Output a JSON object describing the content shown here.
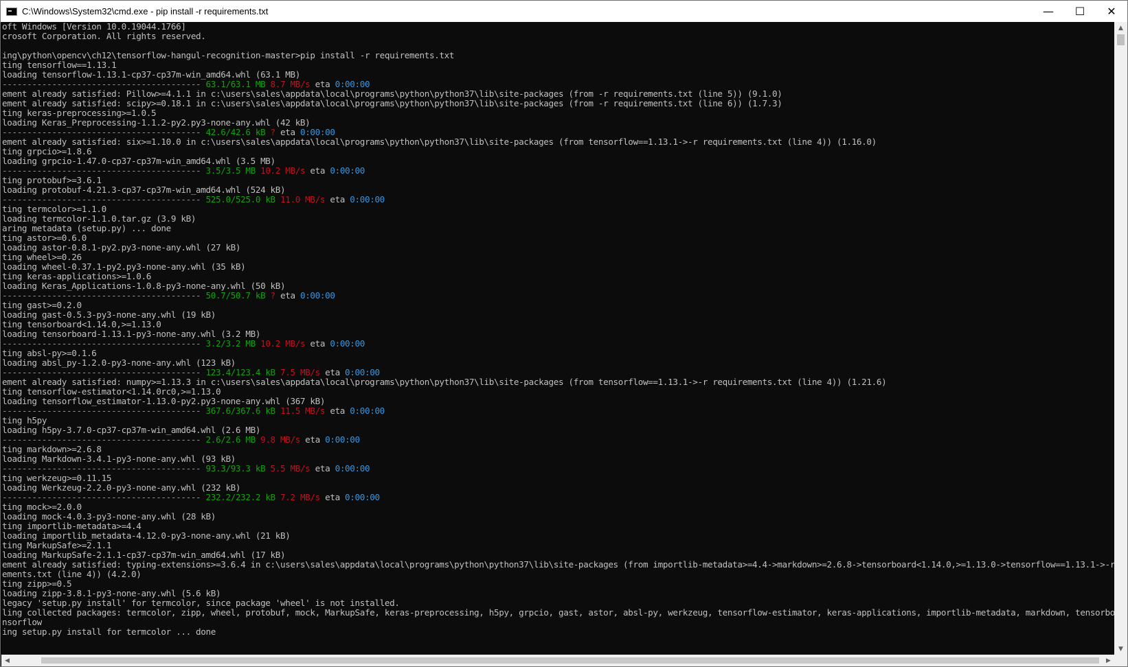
{
  "window": {
    "title": "C:\\Windows\\System32\\cmd.exe - pip  install -r requirements.txt",
    "minimize_glyph": "—",
    "maximize_glyph": "☐",
    "close_glyph": "✕"
  },
  "colors": {
    "text": "#c0c0c0",
    "green": "#13a10e",
    "red": "#c50f1f",
    "blue": "#3a96dd",
    "yellow": "#c19c00",
    "background": "#0c0c0c"
  },
  "console": {
    "lines": [
      {
        "segments": [
          {
            "t": "oft Windows [Version 10.0.19044.1766]"
          }
        ]
      },
      {
        "segments": [
          {
            "t": "crosoft Corporation. All rights reserved."
          }
        ]
      },
      {
        "segments": [
          {
            "t": ""
          }
        ]
      },
      {
        "segments": [
          {
            "t": "ing\\python\\opencv\\ch12\\tensorflow-hangul-recognition-master>pip install -r requirements.txt"
          }
        ]
      },
      {
        "segments": [
          {
            "t": "ting tensorflow==1.13.1"
          }
        ]
      },
      {
        "segments": [
          {
            "t": "loading tensorflow-1.13.1-cp37-cp37m-win_amd64.whl (63.1 MB)"
          }
        ]
      },
      {
        "segments": [
          {
            "t": "----------------------------------------",
            "c": "yellow"
          },
          {
            "t": " 63.1/63.1 MB",
            "c": "green"
          },
          {
            "t": " 8.7 MB/s",
            "c": "red"
          },
          {
            "t": " eta "
          },
          {
            "t": "0:00:00",
            "c": "blue"
          }
        ]
      },
      {
        "segments": [
          {
            "t": "ement already satisfied: Pillow>=4.1.1 in c:\\users\\sales\\appdata\\local\\programs\\python\\python37\\lib\\site-packages (from -r requirements.txt (line 5)) (9.1.0)"
          }
        ]
      },
      {
        "segments": [
          {
            "t": "ement already satisfied: scipy>=0.18.1 in c:\\users\\sales\\appdata\\local\\programs\\python\\python37\\lib\\site-packages (from -r requirements.txt (line 6)) (1.7.3)"
          }
        ]
      },
      {
        "segments": [
          {
            "t": "ting keras-preprocessing>=1.0.5"
          }
        ]
      },
      {
        "segments": [
          {
            "t": "loading Keras_Preprocessing-1.1.2-py2.py3-none-any.whl (42 kB)"
          }
        ]
      },
      {
        "segments": [
          {
            "t": "----------------------------------------",
            "c": "yellow"
          },
          {
            "t": " 42.6/42.6 kB",
            "c": "green"
          },
          {
            "t": " ?",
            "c": "red"
          },
          {
            "t": " eta "
          },
          {
            "t": "0:00:00",
            "c": "blue"
          }
        ]
      },
      {
        "segments": [
          {
            "t": "ement already satisfied: six>=1.10.0 in c:\\users\\sales\\appdata\\local\\programs\\python\\python37\\lib\\site-packages (from tensorflow==1.13.1->-r requirements.txt (line 4)) (1.16.0)"
          }
        ]
      },
      {
        "segments": [
          {
            "t": "ting grpcio>=1.8.6"
          }
        ]
      },
      {
        "segments": [
          {
            "t": "loading grpcio-1.47.0-cp37-cp37m-win_amd64.whl (3.5 MB)"
          }
        ]
      },
      {
        "segments": [
          {
            "t": "----------------------------------------",
            "c": "yellow"
          },
          {
            "t": " 3.5/3.5 MB",
            "c": "green"
          },
          {
            "t": " 10.2 MB/s",
            "c": "red"
          },
          {
            "t": " eta "
          },
          {
            "t": "0:00:00",
            "c": "blue"
          }
        ]
      },
      {
        "segments": [
          {
            "t": "ting protobuf>=3.6.1"
          }
        ]
      },
      {
        "segments": [
          {
            "t": "loading protobuf-4.21.3-cp37-cp37m-win_amd64.whl (524 kB)"
          }
        ]
      },
      {
        "segments": [
          {
            "t": "----------------------------------------",
            "c": "yellow"
          },
          {
            "t": " 525.0/525.0 kB",
            "c": "green"
          },
          {
            "t": " 11.0 MB/s",
            "c": "red"
          },
          {
            "t": " eta "
          },
          {
            "t": "0:00:00",
            "c": "blue"
          }
        ]
      },
      {
        "segments": [
          {
            "t": "ting termcolor>=1.1.0"
          }
        ]
      },
      {
        "segments": [
          {
            "t": "loading termcolor-1.1.0.tar.gz (3.9 kB)"
          }
        ]
      },
      {
        "segments": [
          {
            "t": "aring metadata (setup.py) ... done"
          }
        ]
      },
      {
        "segments": [
          {
            "t": "ting astor>=0.6.0"
          }
        ]
      },
      {
        "segments": [
          {
            "t": "loading astor-0.8.1-py2.py3-none-any.whl (27 kB)"
          }
        ]
      },
      {
        "segments": [
          {
            "t": "ting wheel>=0.26"
          }
        ]
      },
      {
        "segments": [
          {
            "t": "loading wheel-0.37.1-py2.py3-none-any.whl (35 kB)"
          }
        ]
      },
      {
        "segments": [
          {
            "t": "ting keras-applications>=1.0.6"
          }
        ]
      },
      {
        "segments": [
          {
            "t": "loading Keras_Applications-1.0.8-py3-none-any.whl (50 kB)"
          }
        ]
      },
      {
        "segments": [
          {
            "t": "----------------------------------------",
            "c": "yellow"
          },
          {
            "t": " 50.7/50.7 kB",
            "c": "green"
          },
          {
            "t": " ?",
            "c": "red"
          },
          {
            "t": " eta "
          },
          {
            "t": "0:00:00",
            "c": "blue"
          }
        ]
      },
      {
        "segments": [
          {
            "t": "ting gast>=0.2.0"
          }
        ]
      },
      {
        "segments": [
          {
            "t": "loading gast-0.5.3-py3-none-any.whl (19 kB)"
          }
        ]
      },
      {
        "segments": [
          {
            "t": "ting tensorboard<1.14.0,>=1.13.0"
          }
        ]
      },
      {
        "segments": [
          {
            "t": "loading tensorboard-1.13.1-py3-none-any.whl (3.2 MB)"
          }
        ]
      },
      {
        "segments": [
          {
            "t": "----------------------------------------",
            "c": "yellow"
          },
          {
            "t": " 3.2/3.2 MB",
            "c": "green"
          },
          {
            "t": " 10.2 MB/s",
            "c": "red"
          },
          {
            "t": " eta "
          },
          {
            "t": "0:00:00",
            "c": "blue"
          }
        ]
      },
      {
        "segments": [
          {
            "t": "ting absl-py>=0.1.6"
          }
        ]
      },
      {
        "segments": [
          {
            "t": "loading absl_py-1.2.0-py3-none-any.whl (123 kB)"
          }
        ]
      },
      {
        "segments": [
          {
            "t": "----------------------------------------",
            "c": "yellow"
          },
          {
            "t": " 123.4/123.4 kB",
            "c": "green"
          },
          {
            "t": " 7.5 MB/s",
            "c": "red"
          },
          {
            "t": " eta "
          },
          {
            "t": "0:00:00",
            "c": "blue"
          }
        ]
      },
      {
        "segments": [
          {
            "t": "ement already satisfied: numpy>=1.13.3 in c:\\users\\sales\\appdata\\local\\programs\\python\\python37\\lib\\site-packages (from tensorflow==1.13.1->-r requirements.txt (line 4)) (1.21.6)"
          }
        ]
      },
      {
        "segments": [
          {
            "t": "ting tensorflow-estimator<1.14.0rc0,>=1.13.0"
          }
        ]
      },
      {
        "segments": [
          {
            "t": "loading tensorflow_estimator-1.13.0-py2.py3-none-any.whl (367 kB)"
          }
        ]
      },
      {
        "segments": [
          {
            "t": "----------------------------------------",
            "c": "yellow"
          },
          {
            "t": " 367.6/367.6 kB",
            "c": "green"
          },
          {
            "t": " 11.5 MB/s",
            "c": "red"
          },
          {
            "t": " eta "
          },
          {
            "t": "0:00:00",
            "c": "blue"
          }
        ]
      },
      {
        "segments": [
          {
            "t": "ting h5py"
          }
        ]
      },
      {
        "segments": [
          {
            "t": "loading h5py-3.7.0-cp37-cp37m-win_amd64.whl (2.6 MB)"
          }
        ]
      },
      {
        "segments": [
          {
            "t": "----------------------------------------",
            "c": "yellow"
          },
          {
            "t": " 2.6/2.6 MB",
            "c": "green"
          },
          {
            "t": " 9.8 MB/s",
            "c": "red"
          },
          {
            "t": " eta "
          },
          {
            "t": "0:00:00",
            "c": "blue"
          }
        ]
      },
      {
        "segments": [
          {
            "t": "ting markdown>=2.6.8"
          }
        ]
      },
      {
        "segments": [
          {
            "t": "loading Markdown-3.4.1-py3-none-any.whl (93 kB)"
          }
        ]
      },
      {
        "segments": [
          {
            "t": "----------------------------------------",
            "c": "yellow"
          },
          {
            "t": " 93.3/93.3 kB",
            "c": "green"
          },
          {
            "t": " 5.5 MB/s",
            "c": "red"
          },
          {
            "t": " eta "
          },
          {
            "t": "0:00:00",
            "c": "blue"
          }
        ]
      },
      {
        "segments": [
          {
            "t": "ting werkzeug>=0.11.15"
          }
        ]
      },
      {
        "segments": [
          {
            "t": "loading Werkzeug-2.2.0-py3-none-any.whl (232 kB)"
          }
        ]
      },
      {
        "segments": [
          {
            "t": "----------------------------------------",
            "c": "yellow"
          },
          {
            "t": " 232.2/232.2 kB",
            "c": "green"
          },
          {
            "t": " 7.2 MB/s",
            "c": "red"
          },
          {
            "t": " eta "
          },
          {
            "t": "0:00:00",
            "c": "blue"
          }
        ]
      },
      {
        "segments": [
          {
            "t": "ting mock>=2.0.0"
          }
        ]
      },
      {
        "segments": [
          {
            "t": "loading mock-4.0.3-py3-none-any.whl (28 kB)"
          }
        ]
      },
      {
        "segments": [
          {
            "t": "ting importlib-metadata>=4.4"
          }
        ]
      },
      {
        "segments": [
          {
            "t": "loading importlib_metadata-4.12.0-py3-none-any.whl (21 kB)"
          }
        ]
      },
      {
        "segments": [
          {
            "t": "ting MarkupSafe>=2.1.1"
          }
        ]
      },
      {
        "segments": [
          {
            "t": "loading MarkupSafe-2.1.1-cp37-cp37m-win_amd64.whl (17 kB)"
          }
        ]
      },
      {
        "segments": [
          {
            "t": "ement already satisfied: typing-extensions>=3.6.4 in c:\\users\\sales\\appdata\\local\\programs\\python\\python37\\lib\\site-packages (from importlib-metadata>=4.4->markdown>=2.6.8->tensorboard<1.14.0,>=1.13.0->tensorflow==1.13.1->-r"
          }
        ]
      },
      {
        "segments": [
          {
            "t": "ements.txt (line 4)) (4.2.0)"
          }
        ]
      },
      {
        "segments": [
          {
            "t": "ting zipp>=0.5"
          }
        ]
      },
      {
        "segments": [
          {
            "t": "loading zipp-3.8.1-py3-none-any.whl (5.6 kB)"
          }
        ]
      },
      {
        "segments": [
          {
            "t": "legacy 'setup.py install' for termcolor, since package 'wheel' is not installed."
          }
        ]
      },
      {
        "segments": [
          {
            "t": "ling collected packages: termcolor, zipp, wheel, protobuf, mock, MarkupSafe, keras-preprocessing, h5py, grpcio, gast, astor, absl-py, werkzeug, tensorflow-estimator, keras-applications, importlib-metadata, markdown, tensorboa"
          }
        ]
      },
      {
        "segments": [
          {
            "t": "nsorflow"
          }
        ]
      },
      {
        "segments": [
          {
            "t": "ing setup.py install for termcolor ... done"
          }
        ]
      }
    ]
  }
}
